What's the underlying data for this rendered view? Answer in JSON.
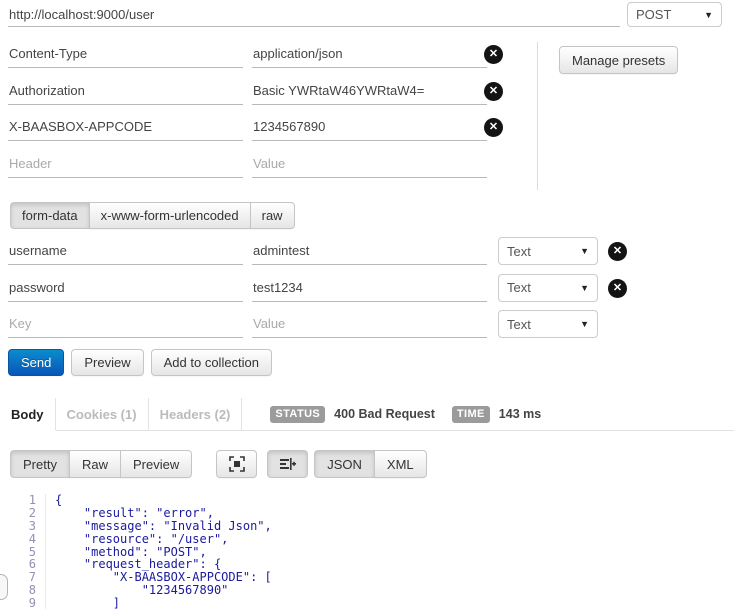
{
  "request": {
    "url": {
      "value": "http://localhost:9000/user"
    },
    "method": {
      "selected": "POST"
    },
    "headers": {
      "rows": [
        {
          "key": "Content-Type",
          "value": "application/json",
          "removable": true
        },
        {
          "key": "Authorization",
          "value": "Basic YWRtaW46YWRtaW4=",
          "removable": true
        },
        {
          "key": "X-BAASBOX-APPCODE",
          "value": "1234567890",
          "removable": true
        },
        {
          "key": "",
          "value": "",
          "key_placeholder": "Header",
          "value_placeholder": "Value",
          "removable": false
        }
      ]
    },
    "manage_presets_label": "Manage presets",
    "body_mode_tabs": [
      {
        "label": "form-data",
        "active": true
      },
      {
        "label": "x-www-form-urlencoded",
        "active": false
      },
      {
        "label": "raw",
        "active": false
      }
    ],
    "form_rows": [
      {
        "key": "username",
        "value": "admintest",
        "type": "Text",
        "removable": true
      },
      {
        "key": "password",
        "value": "test1234",
        "type": "Text",
        "removable": true
      },
      {
        "key": "",
        "value": "",
        "key_placeholder": "Key",
        "value_placeholder": "Value",
        "type": "Text",
        "removable": false
      }
    ],
    "actions": {
      "send": "Send",
      "preview": "Preview",
      "add_to_collection": "Add to collection"
    }
  },
  "response": {
    "tabs": [
      {
        "label": "Body",
        "active": true
      },
      {
        "label": "Cookies (1)",
        "active": false
      },
      {
        "label": "Headers (2)",
        "active": false
      }
    ],
    "status": {
      "label": "STATUS",
      "value": "400 Bad Request"
    },
    "time": {
      "label": "TIME",
      "value": "143 ms"
    },
    "view_tabs": [
      {
        "label": "Pretty",
        "active": true
      },
      {
        "label": "Raw",
        "active": false
      },
      {
        "label": "Preview",
        "active": false
      }
    ],
    "format_tabs": [
      {
        "label": "JSON",
        "active": true
      },
      {
        "label": "XML",
        "active": false
      }
    ],
    "code": {
      "lines": [
        {
          "num": 1,
          "text": "{"
        },
        {
          "num": 2,
          "text": "    \"result\": \"error\","
        },
        {
          "num": 3,
          "text": "    \"message\": \"Invalid Json\","
        },
        {
          "num": 4,
          "text": "    \"resource\": \"/user\","
        },
        {
          "num": 5,
          "text": "    \"method\": \"POST\","
        },
        {
          "num": 6,
          "text": "    \"request_header\": {"
        },
        {
          "num": 7,
          "text": "        \"X-BAASBOX-APPCODE\": ["
        },
        {
          "num": 8,
          "text": "            \"1234567890\""
        },
        {
          "num": 9,
          "text": "        ]"
        }
      ]
    }
  },
  "icons": {
    "dropdown_caret": "▼",
    "remove_glyph": "✕"
  },
  "colors": {
    "primary_blue": "#0a6fc2",
    "badge_gray": "#9b9b9b",
    "code_navy": "#1a1a9e",
    "inactive_tab": "#bbbbbb",
    "underline_gray": "#b9b9b9"
  }
}
